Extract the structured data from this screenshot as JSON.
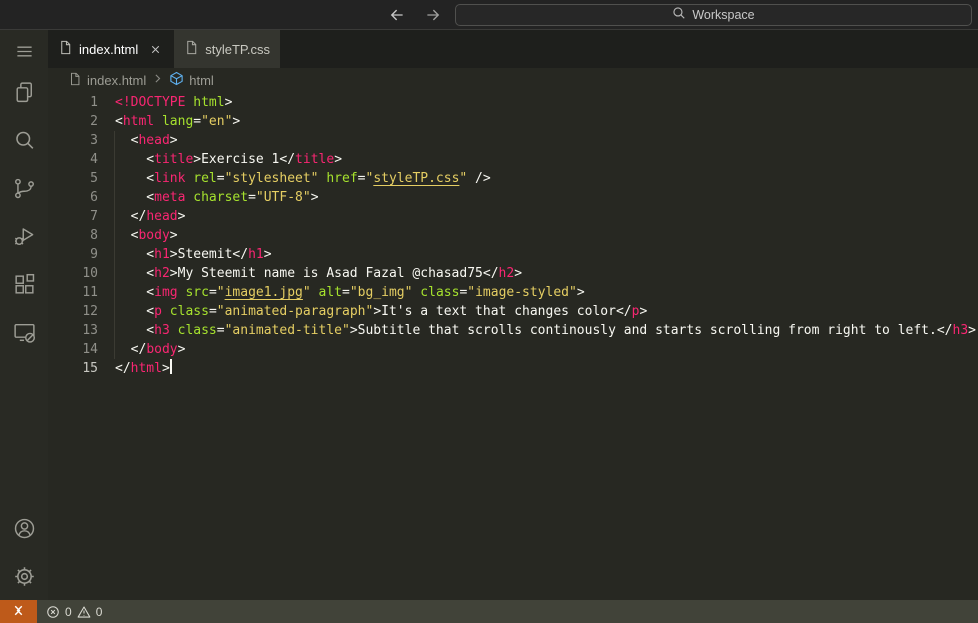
{
  "titlebar": {
    "search_label": "Workspace"
  },
  "tabs": [
    {
      "label": "index.html",
      "active": true
    },
    {
      "label": "styleTP.css",
      "active": false
    }
  ],
  "breadcrumb": {
    "file": "index.html",
    "symbol": "html"
  },
  "editor": {
    "lines": [
      {
        "num": 1,
        "tokens": [
          [
            "<!DOCTYPE",
            "t"
          ],
          [
            " ",
            "p"
          ],
          [
            "html",
            "a"
          ],
          [
            ">",
            "p"
          ]
        ]
      },
      {
        "num": 2,
        "tokens": [
          [
            "<",
            "p"
          ],
          [
            "html",
            "t"
          ],
          [
            " ",
            "p"
          ],
          [
            "lang",
            "a"
          ],
          [
            "=",
            "p"
          ],
          [
            "\"en\"",
            "s"
          ],
          [
            ">",
            "p"
          ]
        ]
      },
      {
        "num": 3,
        "tokens": [
          [
            "  <",
            "p"
          ],
          [
            "head",
            "t"
          ],
          [
            ">",
            "p"
          ]
        ]
      },
      {
        "num": 4,
        "tokens": [
          [
            "    <",
            "p"
          ],
          [
            "title",
            "t"
          ],
          [
            ">",
            "p"
          ],
          [
            "Exercise 1",
            "p"
          ],
          [
            "</",
            "p"
          ],
          [
            "title",
            "t"
          ],
          [
            ">",
            "p"
          ]
        ]
      },
      {
        "num": 5,
        "tokens": [
          [
            "    <",
            "p"
          ],
          [
            "link",
            "t"
          ],
          [
            " ",
            "p"
          ],
          [
            "rel",
            "a"
          ],
          [
            "=",
            "p"
          ],
          [
            "\"stylesheet\"",
            "s"
          ],
          [
            " ",
            "p"
          ],
          [
            "href",
            "a"
          ],
          [
            "=",
            "p"
          ],
          [
            "\"",
            "s"
          ],
          [
            "styleTP.css",
            "l"
          ],
          [
            "\"",
            "s"
          ],
          [
            " />",
            "p"
          ]
        ]
      },
      {
        "num": 6,
        "tokens": [
          [
            "    <",
            "p"
          ],
          [
            "meta",
            "t"
          ],
          [
            " ",
            "p"
          ],
          [
            "charset",
            "a"
          ],
          [
            "=",
            "p"
          ],
          [
            "\"UTF-8\"",
            "s"
          ],
          [
            ">",
            "p"
          ]
        ]
      },
      {
        "num": 7,
        "tokens": [
          [
            "  </",
            "p"
          ],
          [
            "head",
            "t"
          ],
          [
            ">",
            "p"
          ]
        ]
      },
      {
        "num": 8,
        "tokens": [
          [
            "  <",
            "p"
          ],
          [
            "body",
            "t"
          ],
          [
            ">",
            "p"
          ]
        ]
      },
      {
        "num": 9,
        "tokens": [
          [
            "    <",
            "p"
          ],
          [
            "h1",
            "t"
          ],
          [
            ">",
            "p"
          ],
          [
            "Steemit",
            "p"
          ],
          [
            "</",
            "p"
          ],
          [
            "h1",
            "t"
          ],
          [
            ">",
            "p"
          ]
        ]
      },
      {
        "num": 10,
        "tokens": [
          [
            "    <",
            "p"
          ],
          [
            "h2",
            "t"
          ],
          [
            ">",
            "p"
          ],
          [
            "My Steemit name is Asad Fazal @chasad75",
            "p"
          ],
          [
            "</",
            "p"
          ],
          [
            "h2",
            "t"
          ],
          [
            ">",
            "p"
          ]
        ]
      },
      {
        "num": 11,
        "tokens": [
          [
            "    <",
            "p"
          ],
          [
            "img",
            "t"
          ],
          [
            " ",
            "p"
          ],
          [
            "src",
            "a"
          ],
          [
            "=",
            "p"
          ],
          [
            "\"",
            "s"
          ],
          [
            "image1.jpg",
            "l"
          ],
          [
            "\"",
            "s"
          ],
          [
            " ",
            "p"
          ],
          [
            "alt",
            "a"
          ],
          [
            "=",
            "p"
          ],
          [
            "\"bg_img\"",
            "s"
          ],
          [
            " ",
            "p"
          ],
          [
            "class",
            "a"
          ],
          [
            "=",
            "p"
          ],
          [
            "\"image-styled\"",
            "s"
          ],
          [
            ">",
            "p"
          ]
        ]
      },
      {
        "num": 12,
        "tokens": [
          [
            "    <",
            "p"
          ],
          [
            "p",
            "t"
          ],
          [
            " ",
            "p"
          ],
          [
            "class",
            "a"
          ],
          [
            "=",
            "p"
          ],
          [
            "\"animated-paragraph\"",
            "s"
          ],
          [
            ">",
            "p"
          ],
          [
            "It's a text that changes color",
            "p"
          ],
          [
            "</",
            "p"
          ],
          [
            "p",
            "t"
          ],
          [
            ">",
            "p"
          ]
        ]
      },
      {
        "num": 13,
        "tokens": [
          [
            "    <",
            "p"
          ],
          [
            "h3",
            "t"
          ],
          [
            " ",
            "p"
          ],
          [
            "class",
            "a"
          ],
          [
            "=",
            "p"
          ],
          [
            "\"animated-title\"",
            "s"
          ],
          [
            ">",
            "p"
          ],
          [
            "Subtitle that scrolls continously and starts scrolling from right to left.",
            "p"
          ],
          [
            "</",
            "p"
          ],
          [
            "h3",
            "t"
          ],
          [
            ">",
            "p"
          ]
        ]
      },
      {
        "num": 14,
        "tokens": [
          [
            "  </",
            "p"
          ],
          [
            "body",
            "t"
          ],
          [
            ">",
            "p"
          ]
        ]
      },
      {
        "num": 15,
        "active": true,
        "cursor": true,
        "tokens": [
          [
            "</",
            "p"
          ],
          [
            "html",
            "t"
          ],
          [
            ">",
            "p"
          ]
        ]
      }
    ]
  },
  "activitybar": {
    "top_items": [
      "menu",
      "explorer",
      "search",
      "source-control",
      "run-and-debug",
      "extensions",
      "remote-explorer"
    ],
    "bottom_items": [
      "accounts",
      "settings"
    ]
  },
  "statusbar": {
    "errors": "0",
    "warnings": "0"
  },
  "colors": {
    "tag": "#F92672",
    "attr": "#A6E22E",
    "string": "#E5CE63",
    "text": "#F8F8F2",
    "editor-bg": "#272822",
    "activity-bg": "#292A24",
    "tabs-bg": "#1E1F1C",
    "tab-inactive-bg": "#34352F",
    "title-bg": "#232323",
    "status-bg": "#414339",
    "remote-bg": "#BE5A1A",
    "accent-blue": "#5FB0EE",
    "line-number": "#90908A",
    "icon": "#9D9D95"
  }
}
